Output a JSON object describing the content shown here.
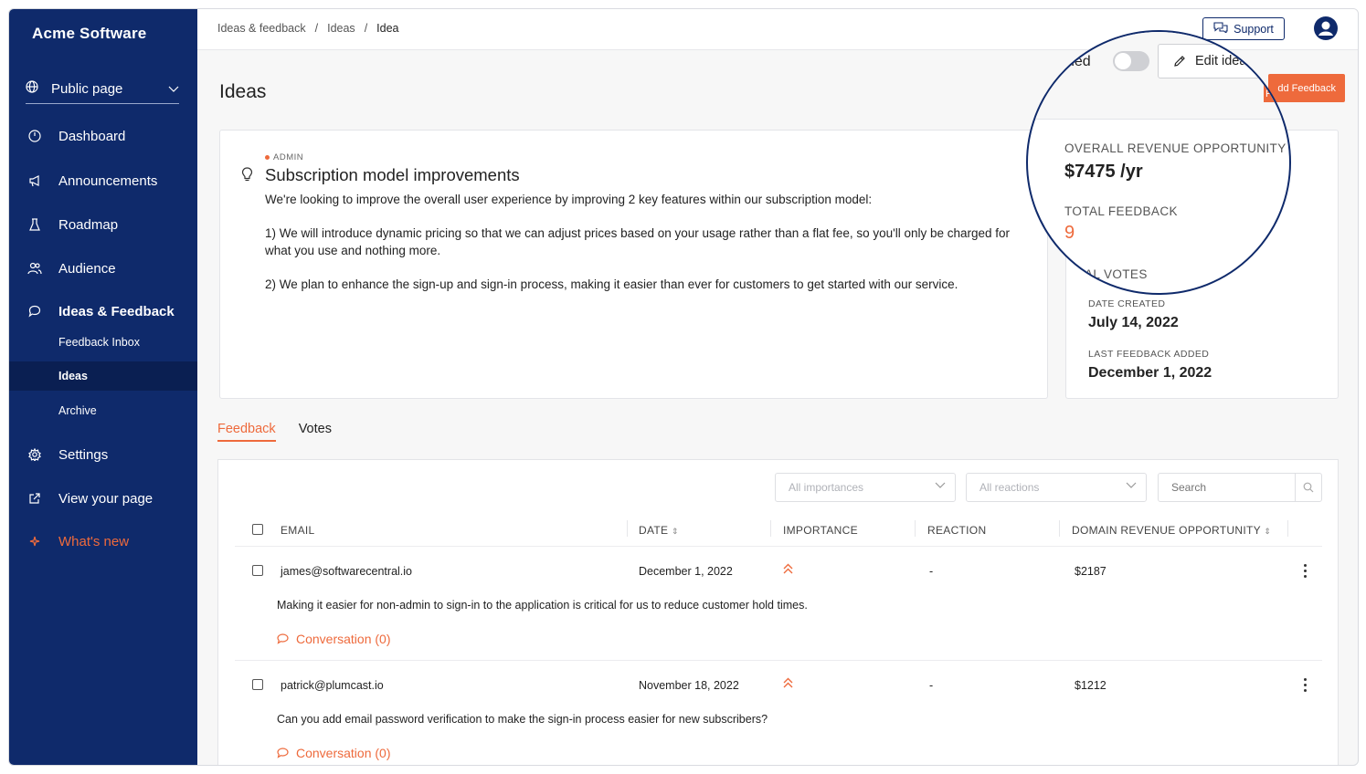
{
  "sidebar": {
    "brand": "Acme Software",
    "public_page": "Public page",
    "items": [
      {
        "label": "Dashboard"
      },
      {
        "label": "Announcements"
      },
      {
        "label": "Roadmap"
      },
      {
        "label": "Audience"
      },
      {
        "label": "Ideas & Feedback"
      },
      {
        "label": "Settings"
      },
      {
        "label": "View your page"
      },
      {
        "label": "What's new"
      }
    ],
    "subitems": [
      {
        "label": "Feedback Inbox"
      },
      {
        "label": "Ideas"
      },
      {
        "label": "Archive"
      }
    ]
  },
  "header": {
    "breadcrumbs": [
      "Ideas & feedback",
      "Ideas",
      "Idea"
    ],
    "support_label": "Support"
  },
  "page": {
    "title": "Ideas",
    "add_feedback": "dd Feedback",
    "toggle_label": "ned",
    "edit_label": "Edit idea"
  },
  "idea": {
    "badge": "ADMIN",
    "title": "Subscription model improvements",
    "paragraphs": [
      "We're looking to improve the overall user experience by improving 2 key features within our subscription model:",
      "1) We will introduce dynamic pricing so that we can adjust prices based on your usage rather than a flat fee, so you'll only be charged for what you use and nothing more.",
      "2) We plan to enhance the sign-up and sign-in process, making it easier than ever for customers to get started with our service."
    ]
  },
  "stats": {
    "revenue_label": "OVERALL REVENUE OPPORTUNITY",
    "revenue_value": "$7475 /yr",
    "feedback_label": "TOTAL FEEDBACK",
    "feedback_value": "9",
    "votes_label": "AL VOTES",
    "created_label": "DATE CREATED",
    "created_value": "July 14, 2022",
    "last_label": "LAST FEEDBACK ADDED",
    "last_value": "December 1, 2022"
  },
  "tabs": {
    "feedback": "Feedback",
    "votes": "Votes"
  },
  "filters": {
    "importance": "All importances",
    "reactions": "All reactions",
    "search_placeholder": "Search"
  },
  "table": {
    "columns": [
      "EMAIL",
      "DATE",
      "IMPORTANCE",
      "REACTION",
      "DOMAIN REVENUE OPPORTUNITY"
    ],
    "rows": [
      {
        "email": "james@softwarecentral.io",
        "date": "December 1, 2022",
        "reaction": "-",
        "revenue": "$2187",
        "comment": "Making it easier for non-admin to sign-in to the application is critical for us to reduce customer hold times.",
        "conversation": "Conversation (0)"
      },
      {
        "email": "patrick@plumcast.io",
        "date": "November 18, 2022",
        "reaction": "-",
        "revenue": "$1212",
        "comment": "Can you add email password verification to make the sign-in process easier for new subscribers?",
        "conversation": "Conversation (0)"
      }
    ]
  },
  "colors": {
    "brand": "#0f2a6b",
    "accent": "#ee6a3c"
  }
}
